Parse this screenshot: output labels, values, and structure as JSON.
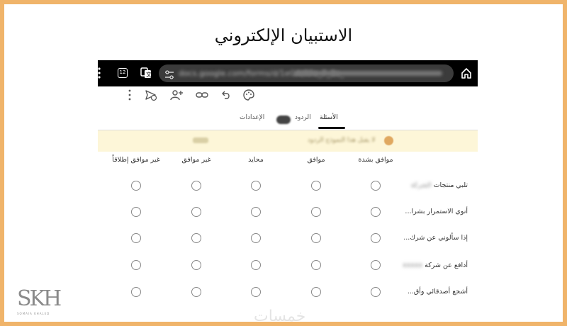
{
  "slide": {
    "title": "الاستبيان الإلكتروني"
  },
  "browser": {
    "tab_count": "12",
    "url": "docs.google.com/forms/d/1eGAtRFe_P_Bs_",
    "icons": {
      "menu": "vertical-dots-icon",
      "tabs": "tab-switcher-icon",
      "translate": "translate-icon",
      "site_info": "tune-icon",
      "home": "home-icon"
    }
  },
  "form_toolbar": {
    "icons": [
      "more-vert-icon",
      "send-icon",
      "add-collaborator-icon",
      "link-icon",
      "undo-icon",
      "palette-icon"
    ]
  },
  "tabs": [
    {
      "label": "الأسئلة",
      "active": true
    },
    {
      "label": "الردود",
      "active": false
    },
    {
      "label": "الإعدادات",
      "active": false
    }
  ],
  "banner": {
    "text": "لا يقبل هذا النموذج الردود",
    "action": "إيقاف"
  },
  "grid": {
    "columns": [
      "موافق بشدة",
      "موافق",
      "محايد",
      "غير موافق",
      "غير موافق إطلاقاً"
    ],
    "rows": [
      {
        "label": "تلبي منتجات ",
        "hidden": "الشركة"
      },
      {
        "label": "أنوي الاستمرار بشرا...",
        "hidden": ""
      },
      {
        "label": "إذا سألوني عن شرك...",
        "hidden": ""
      },
      {
        "label": "أدافع عن شركة ",
        "hidden": "xxxxx"
      },
      {
        "label": "أشجع أصدقائي وأق...",
        "hidden": ""
      }
    ]
  },
  "watermark": {
    "text": "خمسات"
  },
  "logo": {
    "letters": "SKH",
    "subtitle": "SOMAIA KHALED"
  },
  "colors": {
    "frame": "#f0b46a",
    "banner": "#fdf6d8"
  }
}
